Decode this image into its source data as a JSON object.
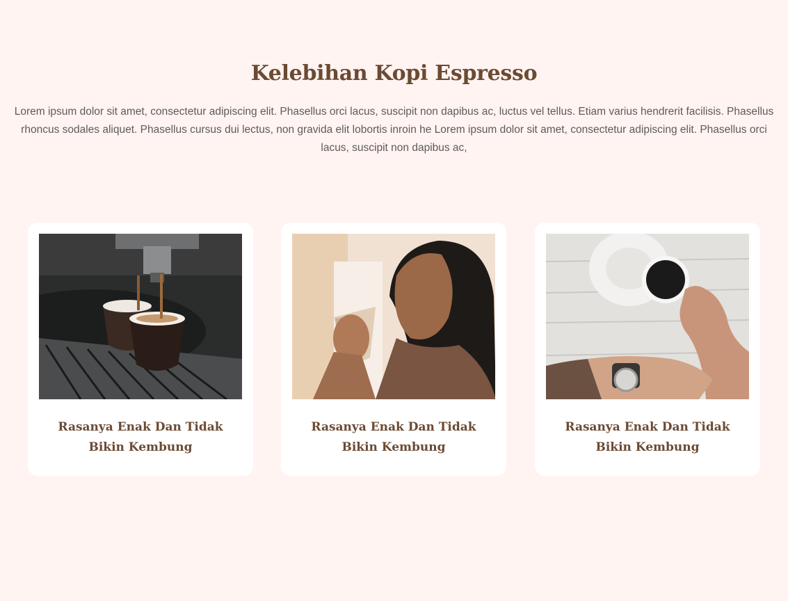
{
  "header": {
    "title": "Kelebihan Kopi Espresso",
    "description": "Lorem ipsum dolor sit amet, consectetur adipiscing elit. Phasellus orci lacus, suscipit non dapibus ac, luctus vel tellus. Etiam varius hendrerit facilisis. Phasellus rhoncus sodales aliquet. Phasellus cursus dui lectus, non gravida elit lobortis inroin he Lorem ipsum dolor sit amet, consectetur adipiscing elit. Phasellus orci lacus, suscipit non dapibus ac,"
  },
  "cards": [
    {
      "title": "Rasanya Enak Dan Tidak Bikin Kembung",
      "image": "espresso-machine-photo"
    },
    {
      "title": "Rasanya Enak Dan Tidak Bikin Kembung",
      "image": "woman-drinking-coffee-photo"
    },
    {
      "title": "Rasanya Enak Dan Tidak Bikin Kembung",
      "image": "coffee-cup-on-table-photo"
    }
  ],
  "colors": {
    "background": "#fff4f2",
    "heading": "#6b4a33",
    "body_text": "#5d5a58",
    "card": "#ffffff"
  }
}
